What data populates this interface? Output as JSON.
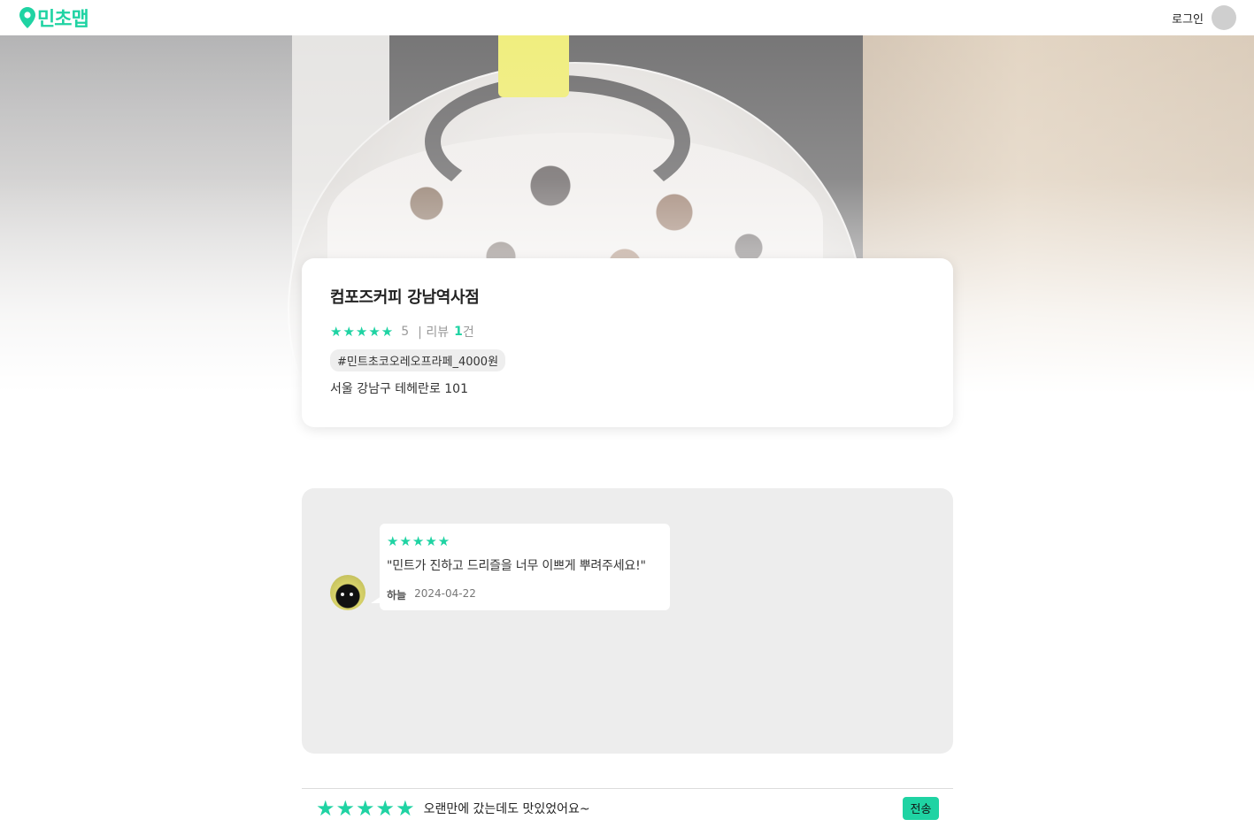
{
  "header": {
    "logo_text": "민초맵",
    "logo_icon": "map-pin-icon",
    "login_label": "로그인"
  },
  "colors": {
    "accent": "#1fd3a3",
    "review_box_bg": "#ededed"
  },
  "store": {
    "name": "컴포즈커피 강남역사점",
    "stars": "★★★★★",
    "rating": "5",
    "review_prefix": "| 리뷰 ",
    "review_count": "1",
    "review_suffix": "건",
    "tag": "#민트초코오레오프라페_4000원",
    "address": "서울 강남구 테헤란로 101"
  },
  "reviews": [
    {
      "stars": "★★★★★",
      "text": "\"민트가 진하고 드리즐을 너무 이쁘게 뿌려주세요!\"",
      "author": "하늘",
      "date": "2024-04-22"
    }
  ],
  "composer": {
    "rating": 5,
    "star_glyph": "★",
    "value": "오랜만에 갔는데도 맛있었어요~",
    "send_label": "전송"
  }
}
